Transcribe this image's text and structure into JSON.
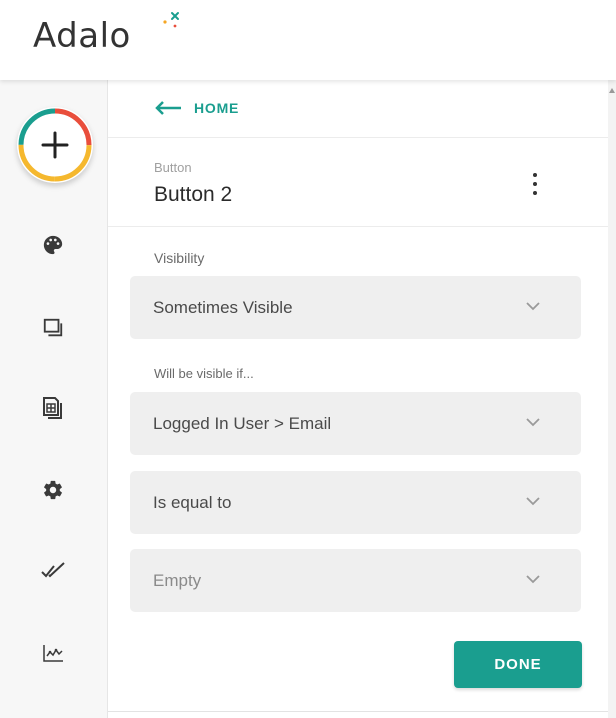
{
  "app": {
    "logo_text": "Adalo"
  },
  "sidebar": {
    "add_button": {
      "icon": "plus-icon"
    },
    "items": [
      {
        "id": "branding",
        "icon": "palette-icon"
      },
      {
        "id": "screens",
        "icon": "screens-icon"
      },
      {
        "id": "database",
        "icon": "database-icon"
      },
      {
        "id": "settings",
        "icon": "gear-icon"
      },
      {
        "id": "publish",
        "icon": "double-check-icon"
      },
      {
        "id": "analytics",
        "icon": "analytics-icon"
      }
    ]
  },
  "panel": {
    "back_label": "HOME",
    "component_type": "Button",
    "component_name": "Button 2",
    "visibility": {
      "label": "Visibility",
      "value": "Sometimes Visible"
    },
    "condition": {
      "label": "Will be visible if...",
      "field": "Logged In User > Email",
      "operator": "Is equal to",
      "compare_value": "Empty"
    },
    "done_label": "DONE"
  },
  "colors": {
    "accent": "#1a9e8f",
    "field_bg": "#efefef"
  }
}
